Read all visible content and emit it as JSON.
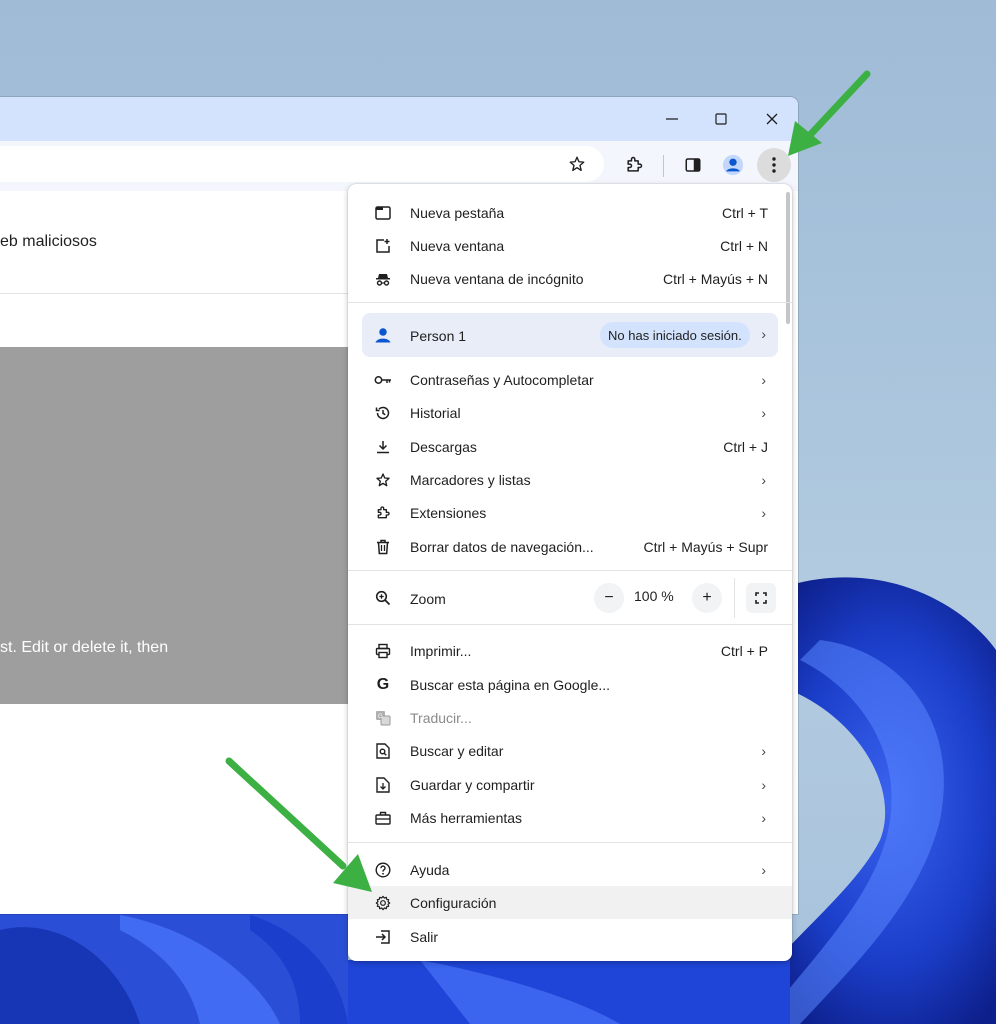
{
  "content": {
    "line1": "eb maliciosos",
    "gray_text": "st. Edit or delete it, then"
  },
  "window": {
    "minimize_glyph": "—",
    "maximize_glyph": "☐",
    "close_glyph": "✕"
  },
  "menu": {
    "group1": [
      {
        "label": "Nueva pestaña",
        "shortcut": "Ctrl + T",
        "icon": "new-tab-icon"
      },
      {
        "label": "Nueva ventana",
        "shortcut": "Ctrl + N",
        "icon": "new-window-icon"
      },
      {
        "label": "Nueva ventana de incógnito",
        "shortcut": "Ctrl + Mayús + N",
        "icon": "incognito-icon"
      }
    ],
    "profile": {
      "name": "Person 1",
      "status": "No has iniciado sesión."
    },
    "group2": [
      {
        "label": "Contraseñas y Autocompletar",
        "icon": "key-icon"
      },
      {
        "label": "Historial",
        "icon": "history-icon"
      },
      {
        "label": "Descargas",
        "shortcut": "Ctrl + J",
        "icon": "download-icon"
      },
      {
        "label": "Marcadores y listas",
        "icon": "star-icon"
      },
      {
        "label": "Extensiones",
        "icon": "puzzle-icon"
      },
      {
        "label": "Borrar datos de navegación...",
        "shortcut": "Ctrl + Mayús + Supr",
        "icon": "trash-icon"
      }
    ],
    "zoom": {
      "label": "Zoom",
      "value": "100 %",
      "minus": "−",
      "plus": "+"
    },
    "group3": [
      {
        "label": "Imprimir...",
        "shortcut": "Ctrl + P",
        "icon": "print-icon"
      },
      {
        "label": "Buscar esta página en Google...",
        "icon": "google-icon"
      },
      {
        "label": "Traducir...",
        "icon": "translate-icon"
      },
      {
        "label": "Buscar y editar",
        "icon": "find-icon"
      },
      {
        "label": "Guardar y compartir",
        "icon": "save-share-icon"
      },
      {
        "label": "Más herramientas",
        "icon": "toolbox-icon"
      }
    ],
    "group4": [
      {
        "label": "Ayuda",
        "icon": "help-icon"
      },
      {
        "label": "Configuración",
        "icon": "gear-icon"
      },
      {
        "label": "Salir",
        "icon": "exit-icon"
      }
    ]
  },
  "colors": {
    "accent": "#1a73e8",
    "arrow": "#3cb043",
    "menu_bg": "#ffffff",
    "titlebar": "#d3e3fd"
  }
}
